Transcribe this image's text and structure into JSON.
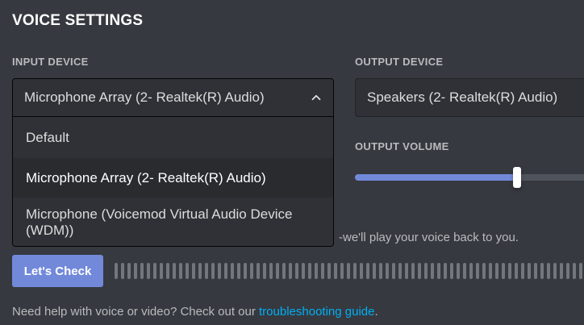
{
  "section": {
    "title": "VOICE SETTINGS"
  },
  "input_device": {
    "label": "INPUT DEVICE",
    "selected": "Microphone Array (2- Realtek(R) Audio)",
    "options": [
      "Default",
      "Microphone Array (2- Realtek(R) Audio)",
      "Microphone (Voicemod Virtual Audio Device (WDM))"
    ],
    "highlighted_index": 1
  },
  "output_device": {
    "label": "OUTPUT DEVICE",
    "selected": "Speakers (2- Realtek(R) Audio)"
  },
  "output_volume": {
    "label": "OUTPUT VOLUME",
    "value_fraction": 0.67
  },
  "mic_test": {
    "description_visible": "-we'll play your voice back to you.",
    "button_label": "Let's Check"
  },
  "help": {
    "prefix": "Need help with voice or video? Check out our ",
    "link_text": "troubleshooting guide",
    "suffix": "."
  },
  "colors": {
    "background": "#36393f",
    "accent": "#7289da",
    "link": "#00b0f4",
    "field_bg": "#2f3136"
  }
}
